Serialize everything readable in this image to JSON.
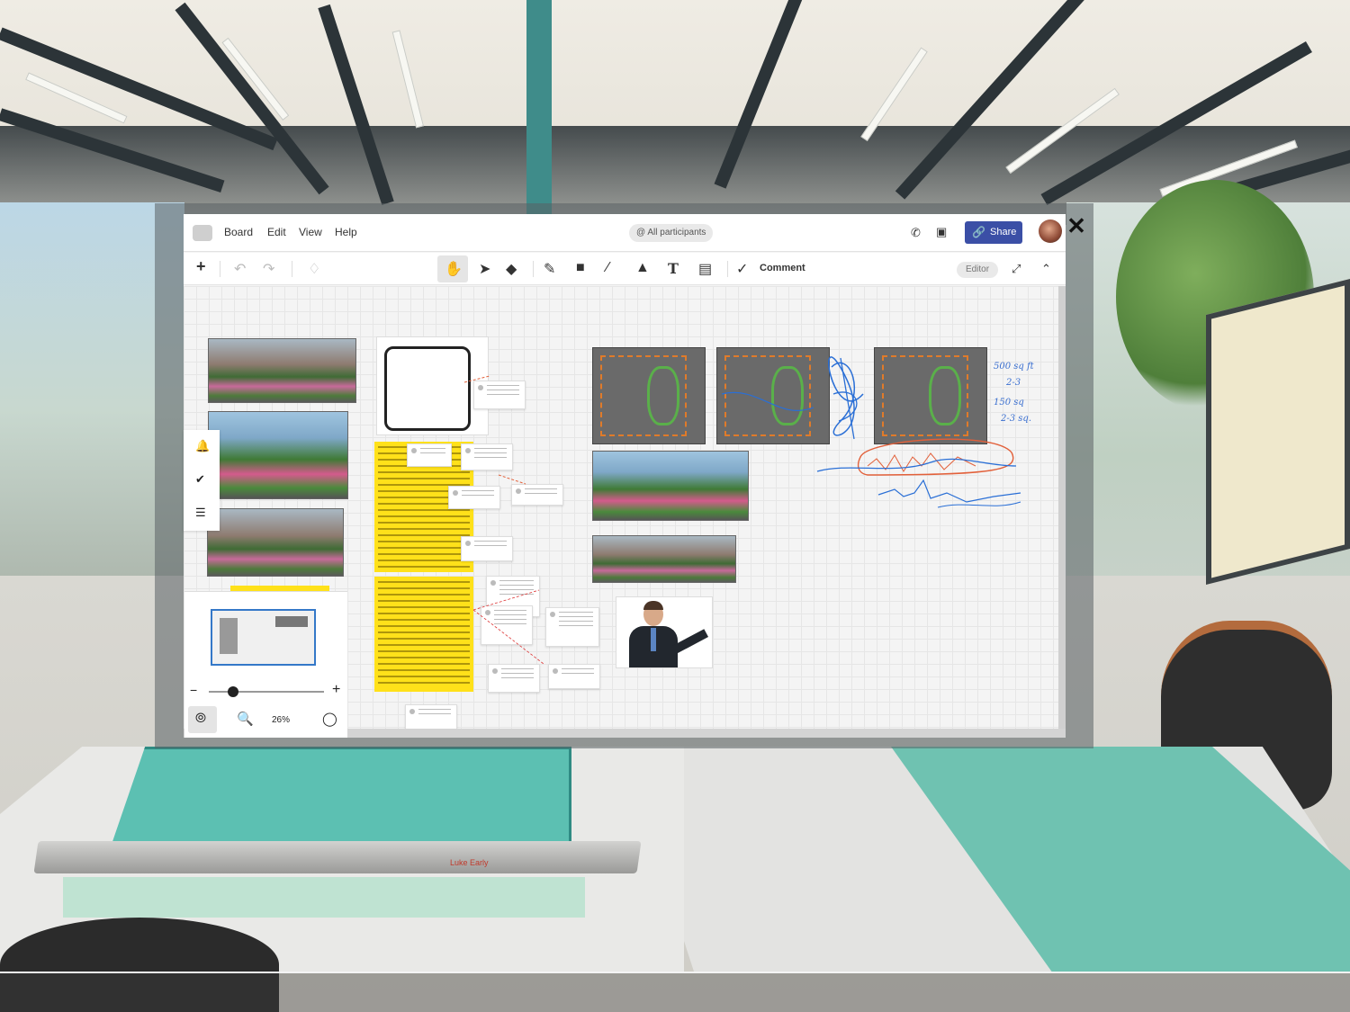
{
  "app": {
    "menu": [
      "Board",
      "Edit",
      "View",
      "Help"
    ],
    "participants_label": "@ All participants",
    "share_label": "Share",
    "close_label": "✕"
  },
  "toolbar": {
    "comment_label": "Comment",
    "editor_badge": "Editor"
  },
  "zoom": {
    "percent": "26%",
    "minus": "−",
    "plus": "+"
  },
  "canvas": {
    "handwritten": [
      "500 sq ft",
      "2-3",
      "150 sq",
      "2-3 sq."
    ]
  },
  "environment": {
    "desk_label": "Luke Early"
  },
  "icons": {
    "add": "plus-icon",
    "undo": "undo-icon",
    "redo": "redo-icon",
    "format_painter": "paint-roller-icon",
    "pan": "hand-icon",
    "select": "cursor-icon",
    "eraser": "eraser-icon",
    "pen": "pen-icon",
    "highlighter": "marker-icon",
    "line": "line-icon",
    "shapes": "shapes-icon",
    "text": "text-icon",
    "sticky": "sticky-note-icon",
    "comment": "comment-icon",
    "fullscreen": "expand-icon",
    "collapse": "chevron-up-icon",
    "phone": "phone-icon",
    "video": "video-icon"
  },
  "colors": {
    "share_button": "#3b4fa6",
    "sticky": "#ffe11a",
    "minimap_viewport": "#3478c8"
  }
}
